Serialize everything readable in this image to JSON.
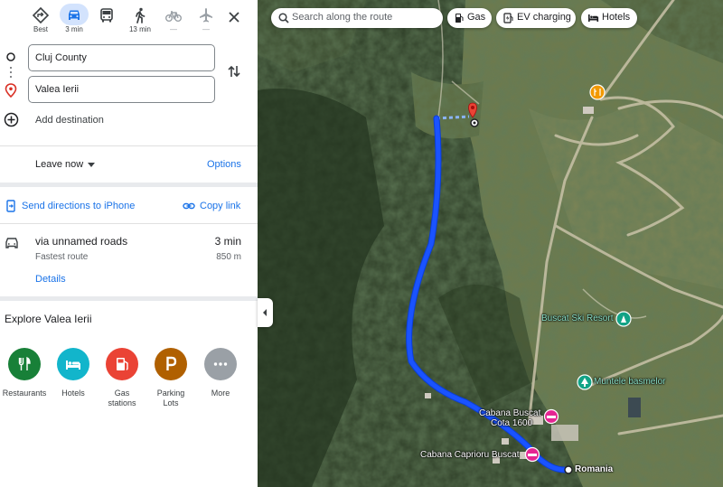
{
  "travel_modes": [
    {
      "name": "best",
      "label": "Best"
    },
    {
      "name": "driving",
      "label": "3 min"
    },
    {
      "name": "transit",
      "label": ""
    },
    {
      "name": "walking",
      "label": "13 min"
    },
    {
      "name": "cycling",
      "label": "—"
    },
    {
      "name": "flight",
      "label": "—"
    }
  ],
  "directions": {
    "origin": "Cluj County",
    "destination": "Valea Ierii",
    "add_destination": "Add destination",
    "leave_now": "Leave now",
    "options": "Options",
    "send_to_phone": "Send directions to iPhone",
    "copy_link": "Copy link"
  },
  "route": {
    "via": "via unnamed roads",
    "time": "3 min",
    "subtitle": "Fastest route",
    "distance": "850 m",
    "details": "Details"
  },
  "explore": {
    "title": "Explore Valea Ierii",
    "categories": [
      {
        "label": "Restaurants",
        "color": "#188038",
        "icon": "fork-knife-icon"
      },
      {
        "label": "Hotels",
        "color": "#12b5cb",
        "icon": "bed-icon"
      },
      {
        "label": "Gas stations",
        "color": "#ea4335",
        "icon": "fuel-icon"
      },
      {
        "label": "Parking Lots",
        "color": "#b06000",
        "icon": "parking-icon"
      },
      {
        "label": "More",
        "color": "#9aa0a6",
        "icon": "more-icon"
      }
    ]
  },
  "map": {
    "search_placeholder": "Search along the route",
    "chips": [
      "Gas",
      "EV charging",
      "Hotels"
    ],
    "labels": {
      "ski_resort": "Buscat Ski Resort",
      "muntele": "Muntele basmelor",
      "cabana_buscat": "Cabana Buscat",
      "cota": "Cota 1600",
      "cabana_caprioru": "Cabana Caprioru Buscat",
      "romania": "Romania"
    },
    "route_color": "#1a53ff"
  }
}
